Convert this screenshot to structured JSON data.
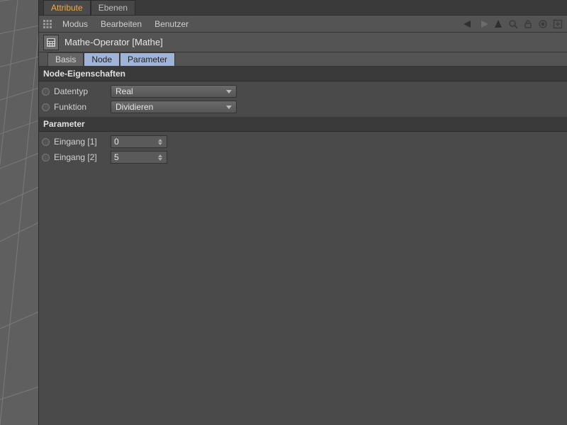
{
  "top_tabs": {
    "attribute": "Attribute",
    "ebenen": "Ebenen"
  },
  "menubar": {
    "modus": "Modus",
    "bearbeiten": "Bearbeiten",
    "benutzer": "Benutzer"
  },
  "object": {
    "title": "Mathe-Operator [Mathe]"
  },
  "sub_tabs": {
    "basis": "Basis",
    "node": "Node",
    "parameter": "Parameter"
  },
  "sections": {
    "node_props": "Node-Eigenschaften",
    "parameter": "Parameter"
  },
  "fields": {
    "datentyp": {
      "label": "Datentyp",
      "value": "Real"
    },
    "funktion": {
      "label": "Funktion",
      "value": "Dividieren"
    },
    "eingang1": {
      "label": "Eingang [1]",
      "value": "0"
    },
    "eingang2": {
      "label": "Eingang [2]",
      "value": "5"
    }
  }
}
